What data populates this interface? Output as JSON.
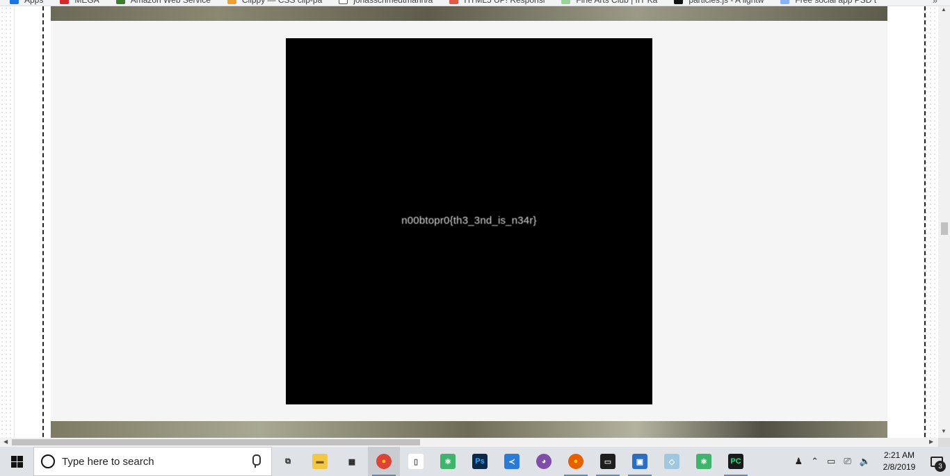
{
  "bookmarks": [
    {
      "label": "Apps",
      "icon": "apps-grid-icon",
      "color": "#1a73e8"
    },
    {
      "label": "MEGA",
      "icon": "mega-icon",
      "color": "#d9272e"
    },
    {
      "label": "Amazon Web Service",
      "icon": "aws-icon",
      "color": "#3f7d2e"
    },
    {
      "label": "Clippy — CSS clip-pa",
      "icon": "clippy-icon",
      "color": "#f0a030"
    },
    {
      "label": "jonasschmedtmann/a",
      "icon": "file-icon",
      "color": "#ffffff"
    },
    {
      "label": "HTML5 UP! Responsi",
      "icon": "html5up-icon",
      "color": "#e0594b"
    },
    {
      "label": "Fine Arts Club | IIT Ka",
      "icon": "fineart-icon",
      "color": "#9bd49a"
    },
    {
      "label": "particles.js - A lightw",
      "icon": "particles-icon",
      "color": "#111111"
    },
    {
      "label": "Free social app PSD t",
      "icon": "link-icon",
      "color": "#8ab4f8"
    }
  ],
  "bookmarks_overflow": "»",
  "flag_text": "n00btopr0{th3_3nd_is_n34r}",
  "scroll": {
    "up": "▲",
    "down": "▼",
    "left": "◀",
    "right": "▶"
  },
  "taskbar": {
    "search_placeholder": "Type here to search",
    "apps": [
      {
        "name": "task-view",
        "glyph": "⧉",
        "color": "#dfe2e6",
        "fg": "#222",
        "running": false,
        "active": false
      },
      {
        "name": "file-explorer",
        "glyph": "▬",
        "color": "#f2c744",
        "fg": "#7a5a10",
        "running": false,
        "active": false
      },
      {
        "name": "microsoft-store",
        "glyph": "▦",
        "color": "#dfe2e6",
        "fg": "#222",
        "running": false,
        "active": false
      },
      {
        "name": "chrome",
        "glyph": "●",
        "color": "#db4437",
        "fg": "#f4c20d",
        "running": true,
        "active": true
      },
      {
        "name": "notepad",
        "glyph": "▯",
        "color": "#ffffff",
        "fg": "#555",
        "running": false,
        "active": false
      },
      {
        "name": "atom",
        "glyph": "⚛",
        "color": "#3fb46b",
        "fg": "#ffffff",
        "running": false,
        "active": false
      },
      {
        "name": "photoshop",
        "glyph": "Ps",
        "color": "#0b2a4a",
        "fg": "#31a8ff",
        "running": false,
        "active": false
      },
      {
        "name": "vscode",
        "glyph": "≺",
        "color": "#2a7ad6",
        "fg": "#ffffff",
        "running": false,
        "active": false
      },
      {
        "name": "github-desktop",
        "glyph": "◕",
        "color": "#7e4ea8",
        "fg": "#ffffff",
        "running": false,
        "active": false
      },
      {
        "name": "firefox",
        "glyph": "●",
        "color": "#e66000",
        "fg": "#ffcb00",
        "running": true,
        "active": false
      },
      {
        "name": "terminal",
        "glyph": "▭",
        "color": "#1e1e1e",
        "fg": "#cccccc",
        "running": true,
        "active": false
      },
      {
        "name": "photos",
        "glyph": "▣",
        "color": "#2d6ec0",
        "fg": "#ffffff",
        "running": true,
        "active": false
      },
      {
        "name": "sketch",
        "glyph": "◇",
        "color": "#9fc8e0",
        "fg": "#ffffff",
        "running": false,
        "active": false
      },
      {
        "name": "atom-2",
        "glyph": "⚛",
        "color": "#3fb46b",
        "fg": "#ffffff",
        "running": false,
        "active": false
      },
      {
        "name": "pycharm",
        "glyph": "PC",
        "color": "#1b1b1b",
        "fg": "#27e07a",
        "running": true,
        "active": false
      }
    ],
    "tray": [
      "♟",
      "⌃",
      "▭",
      "⎚",
      "🔈"
    ],
    "time": "2:21 AM",
    "date": "2/8/2019",
    "notification_count": "3"
  }
}
